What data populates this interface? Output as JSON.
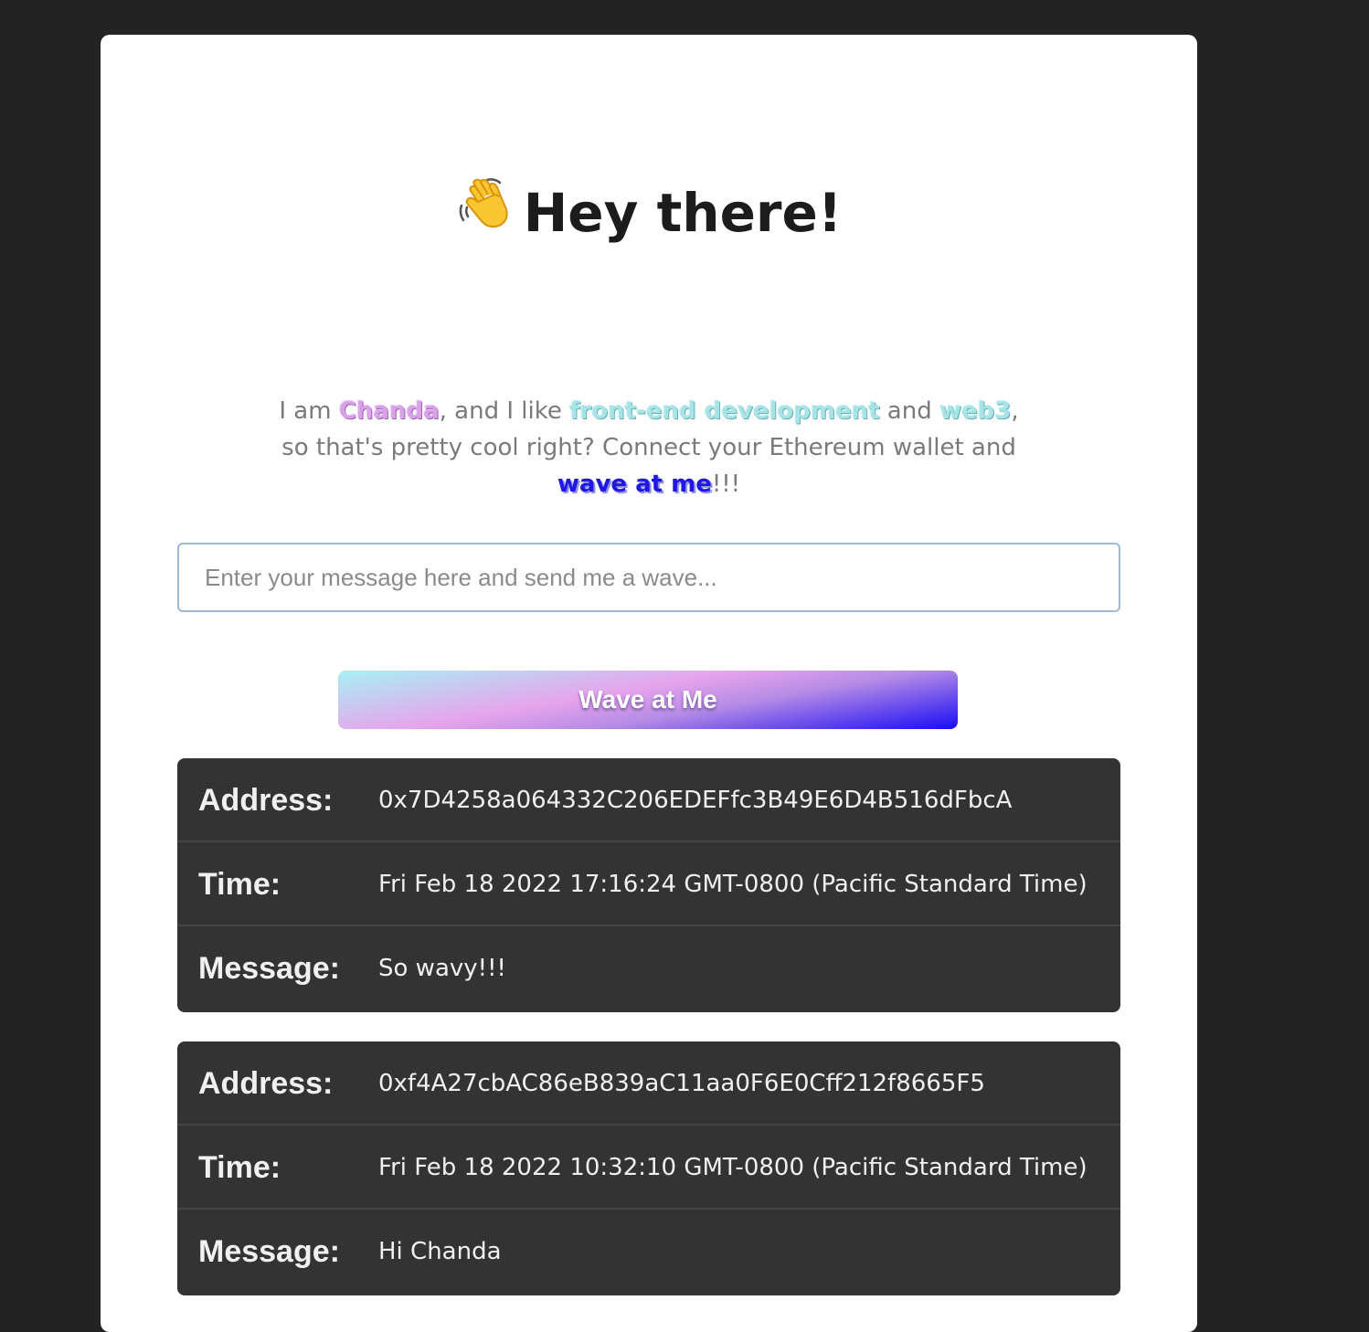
{
  "header": {
    "emoji": "👋",
    "title": "Hey there!"
  },
  "bio": {
    "intro": "I am ",
    "name": "Chanda",
    "mid1": ", and I like ",
    "interest1": "front-end development",
    "mid2": " and ",
    "interest2": "web3",
    "mid3": ", so that's pretty cool right? Connect your Ethereum wallet and ",
    "cta": "wave at me",
    "end": "!!!"
  },
  "message_input": {
    "value": "",
    "placeholder": "Enter your message here and send me a wave..."
  },
  "wave_button": {
    "label": "Wave at Me"
  },
  "labels": {
    "address": "Address:",
    "time": "Time:",
    "message": "Message:"
  },
  "waves": [
    {
      "address": "0x7D4258a064332C206EDEFfc3B49E6D4B516dFbcA",
      "time": "Fri Feb 18 2022 17:16:24 GMT-0800 (Pacific Standard Time)",
      "message": "So wavy!!!"
    },
    {
      "address": "0xf4A27cbAC86eB839aC11aa0F6E0Cff212f8665F5",
      "time": "Fri Feb 18 2022 10:32:10 GMT-0800 (Pacific Standard Time)",
      "message": "Hi Chanda"
    }
  ],
  "colors": {
    "page_background": "#232323",
    "card_background": "#ffffff",
    "entry_background": "#333333",
    "name_highlight": "#d7a3e6",
    "interest_highlight": "#a9e3e6",
    "cta_highlight": "#1f17e6"
  }
}
